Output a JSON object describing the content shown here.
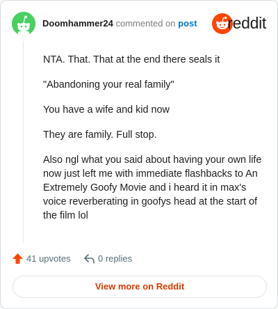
{
  "header": {
    "username": "Doomhammer24",
    "action_text": "commented on",
    "post_link": "post",
    "brand_name": "reddit"
  },
  "comment": {
    "paragraphs": [
      "NTA. That. That at the end there seals it",
      "\"Abandoning your real family\"",
      "You have a wife and kid now",
      "They are family. Full stop.",
      "Also ngl what you said about having your own life now just left me with immediate flashbacks to An Extremely Goofy Movie and i heard it in max's voice reverberating in goofys head at the start of the film lol"
    ]
  },
  "actions": {
    "upvotes": "41 upvotes",
    "replies": "0 replies"
  },
  "footer": {
    "view_more": "View more on Reddit"
  },
  "icons": {
    "avatar": "snoo-avatar-icon",
    "brand": "reddit-logo-icon",
    "upvote": "upvote-arrow-icon",
    "reply": "reply-arrow-icon"
  },
  "colors": {
    "brand_orange": "#ff4500",
    "avatar_bg": "#46d160",
    "link_blue": "#0079d3",
    "button_text": "#d93a00",
    "text": "#1c1c1c",
    "muted": "#7c7c7c"
  }
}
